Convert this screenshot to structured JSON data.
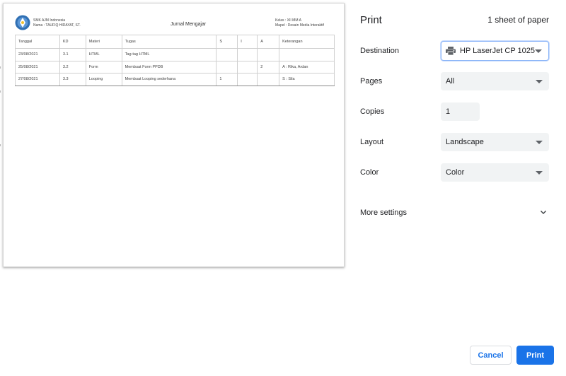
{
  "document": {
    "school": "SMK AJM Indonesia",
    "teacher": "Nama : TAUFIQ HIDAYAT, ST.",
    "title": "Jurnal Mengajar",
    "kelas": "Kelas : XII MM A",
    "mapel": "Mapel : Desain Media Interaktif",
    "columns": [
      "Tanggal",
      "KD",
      "Materi",
      "Tugas",
      "S",
      "I",
      "A",
      "Keterangan"
    ],
    "rows": [
      [
        "23/08/2021",
        "3.1",
        "HTML",
        "Tag-tag HTML",
        "",
        "",
        "",
        ""
      ],
      [
        "25/08/2021",
        "3.2",
        "Form",
        "Membuat Form PPDB",
        "",
        "",
        "2",
        "A : Rika, Ardan"
      ],
      [
        "27/08/2021",
        "3.3",
        "Looping",
        "Membuat Looping sederhana",
        "1",
        "",
        "",
        "S : Sila"
      ]
    ]
  },
  "panel": {
    "title": "Print",
    "sheet_count": "1 sheet of paper",
    "destination_label": "Destination",
    "destination_value": "HP LaserJet CP 1025",
    "pages_label": "Pages",
    "pages_value": "All",
    "copies_label": "Copies",
    "copies_value": "1",
    "layout_label": "Layout",
    "layout_value": "Landscape",
    "color_label": "Color",
    "color_value": "Color",
    "more_settings": "More settings",
    "cancel_label": "Cancel",
    "print_label": "Print"
  },
  "icons": {
    "printer": "printer-icon",
    "dropdown": "caret-down-icon",
    "expand": "chevron-down-icon",
    "logo": "tut-wuri-handayani-logo"
  },
  "colors": {
    "accent": "#1a73e8",
    "field_bg": "#f1f3f4"
  }
}
